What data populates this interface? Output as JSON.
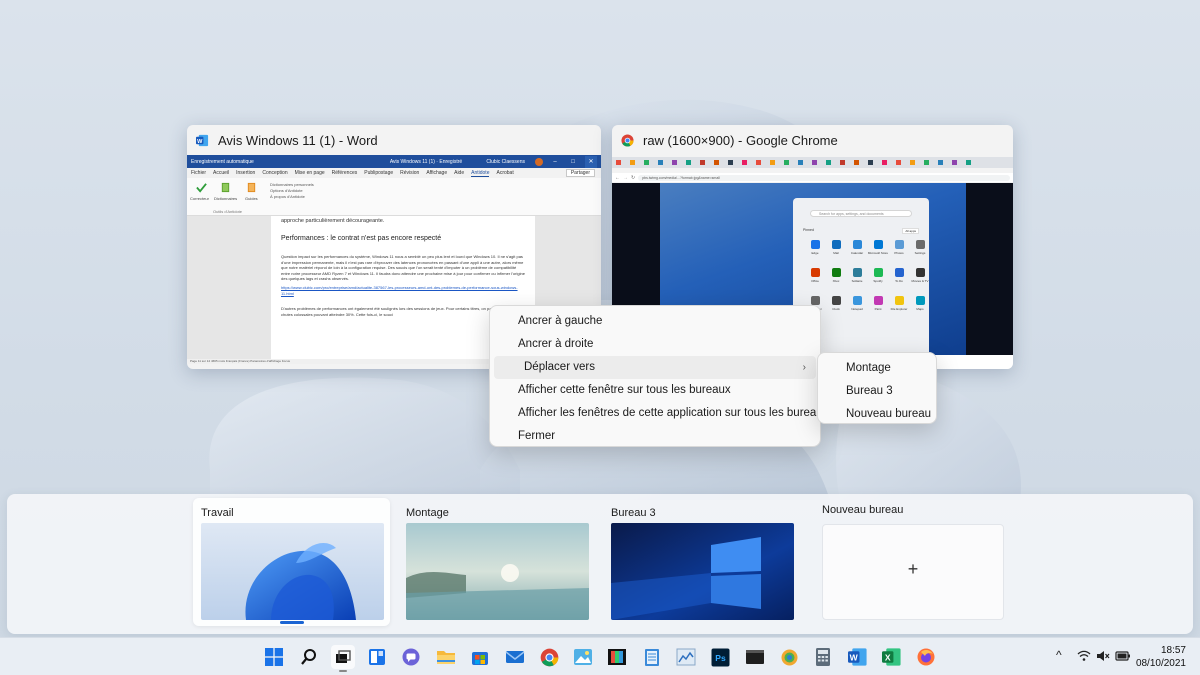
{
  "windows": {
    "word": {
      "title": "Avis Windows 11 (1) - Word",
      "titlebar_left": "Enregistrement automatique",
      "titlebar_center": "Avis Windows 11 (1) · Enregistré",
      "titlebar_user": "Clubic Claessens",
      "tabs": [
        "Fichier",
        "Accueil",
        "Insertion",
        "Conception",
        "Mise en page",
        "Références",
        "Publipostage",
        "Révision",
        "Affichage",
        "Aide",
        "Antidote",
        "Acrobat"
      ],
      "active_tab": "Antidote",
      "share_label": "Partager",
      "ribbon": {
        "correcteur": "Correcteur",
        "dictionnaires": "Dictionnaires",
        "guides": "Guides",
        "group": "Outils d'Antidote",
        "list": [
          "Dictionnaires personnels",
          "Options d'Antidote",
          "À propos d'Antidote"
        ]
      },
      "doc": {
        "top_line": "approche particulièrement décourageante.",
        "heading": "Performances : le contrat n'est pas encore respecté",
        "paragraph1": "Question impact sur les performances du système, Windows 11 nous a semblé un peu plus lent et lourd que Windows 10. Il ne s'agit pas d'une impression permanente, mais il n'est pas rare d'éprouver des latences prononcées en passant d'une appli à une autre, alors même que notre matériel répond de loin à la configuration requise. Des soucis que l'on serait tenté d'imputer à un problème de compatibilité entre notre processeur AMD Ryzen 7 et Windows 11. Il faudra donc attendre une prochaine mise à jour pour confirmer ou infirmer l'origine des quelques lags et crashs observés.",
        "link": "https://www.clubic.com/pro/entreprise/amd/actualite-387567-les-processeurs-amd-ont-des-problemes-de-performance-sous-windows-11.html",
        "paragraph2": "D'autres problèmes de performances ont également été soulignés lors des sessions de jeux. Pour certains titres, on parle même de chutes colossales pouvant atteindre 30%. Cette fois-ci, le souci",
        "status": "Page 11 sur 12   4665 mots   Français (France)   Paramètres d'affichage   Focus"
      }
    },
    "chrome": {
      "title": "raw (1600×900) - Google Chrome",
      "url": "pbs.twimg.com/media/...?format=jpg&name=small",
      "search_placeholder": "Search for apps, settings, and documents",
      "pinned_label": "Pinned",
      "all_apps": "All apps",
      "start_apps": [
        "Edge",
        "Mail",
        "Calendar",
        "Microsoft Store",
        "Photos",
        "Settings",
        "Office",
        "Xbox",
        "Solitaire",
        "Spotify",
        "To Do",
        "Movies & TV",
        "Calculator",
        "Clock",
        "Notepad",
        "Paint",
        "File Explorer",
        "Maps"
      ]
    }
  },
  "context_menu": {
    "items": [
      "Ancrer à gauche",
      "Ancrer à droite",
      "Déplacer vers",
      "Afficher cette fenêtre sur tous les bureaux",
      "Afficher les fenêtres de cette application sur tous les bureaux",
      "Fermer"
    ],
    "submenu_chevron": "›"
  },
  "submenu": {
    "items": [
      "Montage",
      "Bureau 3",
      "Nouveau bureau"
    ]
  },
  "desktops": [
    {
      "label": "Travail",
      "active": true
    },
    {
      "label": "Montage",
      "active": false
    },
    {
      "label": "Bureau 3",
      "active": false
    }
  ],
  "new_desktop": {
    "label": "Nouveau bureau",
    "plus": "+"
  },
  "taskbar": {
    "apps": [
      "windows-start",
      "search",
      "task-view",
      "widgets",
      "teams-chat",
      "file-explorer",
      "store",
      "mail",
      "chrome",
      "photos",
      "film",
      "notepad",
      "chart-app",
      "photoshop",
      "terminal",
      "earth-app",
      "calculator",
      "word",
      "excel",
      "firefox"
    ],
    "tray": {
      "chevron": "^"
    },
    "clock": {
      "time": "18:57",
      "date": "08/10/2021"
    }
  },
  "colors": {
    "accent": "#1a64d3",
    "word_blue": "#1f4e9c",
    "excel_green": "#1e7145"
  }
}
